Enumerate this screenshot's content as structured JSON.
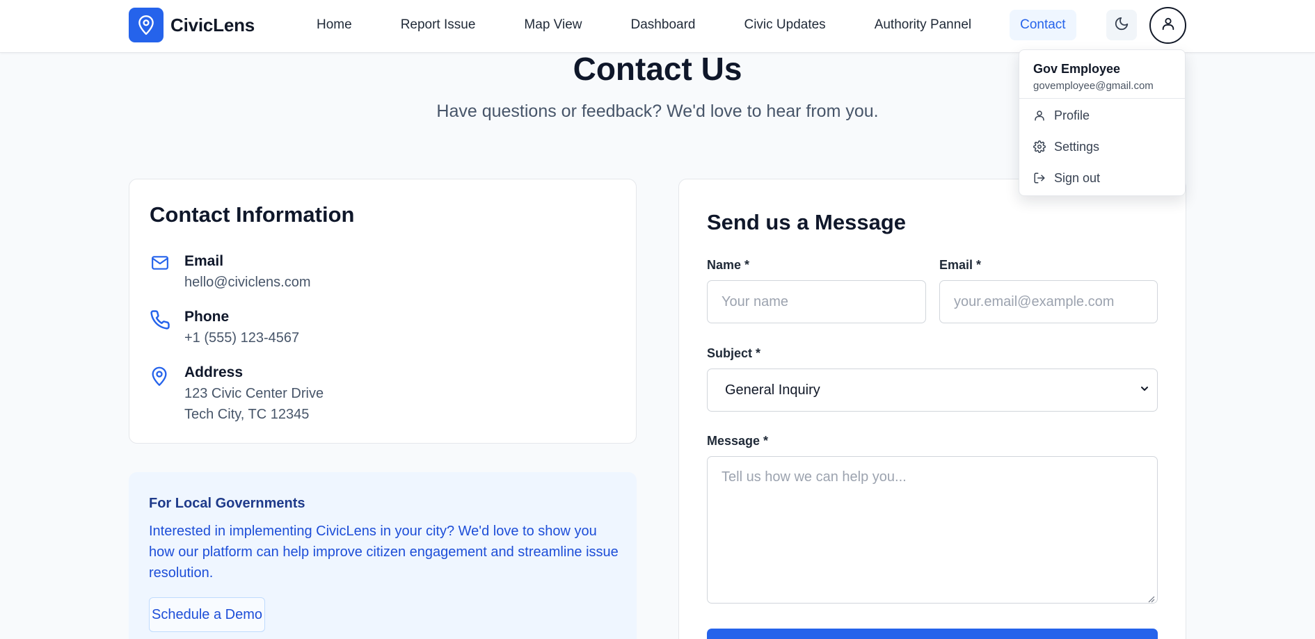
{
  "brand": {
    "name": "CivicLens",
    "logo_icon": "map-pin-icon",
    "accent": "#2563eb"
  },
  "nav": {
    "items": [
      {
        "label": "Home",
        "active": false
      },
      {
        "label": "Report Issue",
        "active": false
      },
      {
        "label": "Map View",
        "active": false
      },
      {
        "label": "Dashboard",
        "active": false
      },
      {
        "label": "Civic Updates",
        "active": false
      },
      {
        "label": "Authority Pannel",
        "active": false
      },
      {
        "label": "Contact",
        "active": true
      }
    ],
    "theme_icon": "moon-icon",
    "avatar_icon": "user-icon"
  },
  "page": {
    "title": "Contact Us",
    "subtitle": "Have questions or feedback? We'd love to hear from you."
  },
  "contact_info": {
    "title": "Contact Information",
    "email": {
      "label": "Email",
      "value": "hello@civiclens.com",
      "icon": "mail-icon"
    },
    "phone": {
      "label": "Phone",
      "value": "+1 (555) 123-4567",
      "icon": "phone-icon"
    },
    "address": {
      "label": "Address",
      "line1": "123 Civic Center Drive",
      "line2": "Tech City, TC 12345",
      "icon": "map-pin-icon"
    }
  },
  "gov": {
    "title": "For Local Governments",
    "text": "Interested in implementing CivicLens in your city? We'd love to show you how our platform can help improve citizen engagement and streamline issue resolution.",
    "button": "Schedule a Demo"
  },
  "form": {
    "title": "Send us a Message",
    "name_label": "Name *",
    "name_placeholder": "Your name",
    "email_label": "Email *",
    "email_placeholder": "your.email@example.com",
    "subject_label": "Subject *",
    "subject_value": "General Inquiry",
    "message_label": "Message *",
    "message_placeholder": "Tell us how we can help you..."
  },
  "user_menu": {
    "name": "Gov Employee",
    "email": "govemployee@gmail.com",
    "items": [
      {
        "label": "Profile",
        "icon": "user-icon"
      },
      {
        "label": "Settings",
        "icon": "gear-icon"
      },
      {
        "label": "Sign out",
        "icon": "sign-out-icon"
      }
    ]
  }
}
